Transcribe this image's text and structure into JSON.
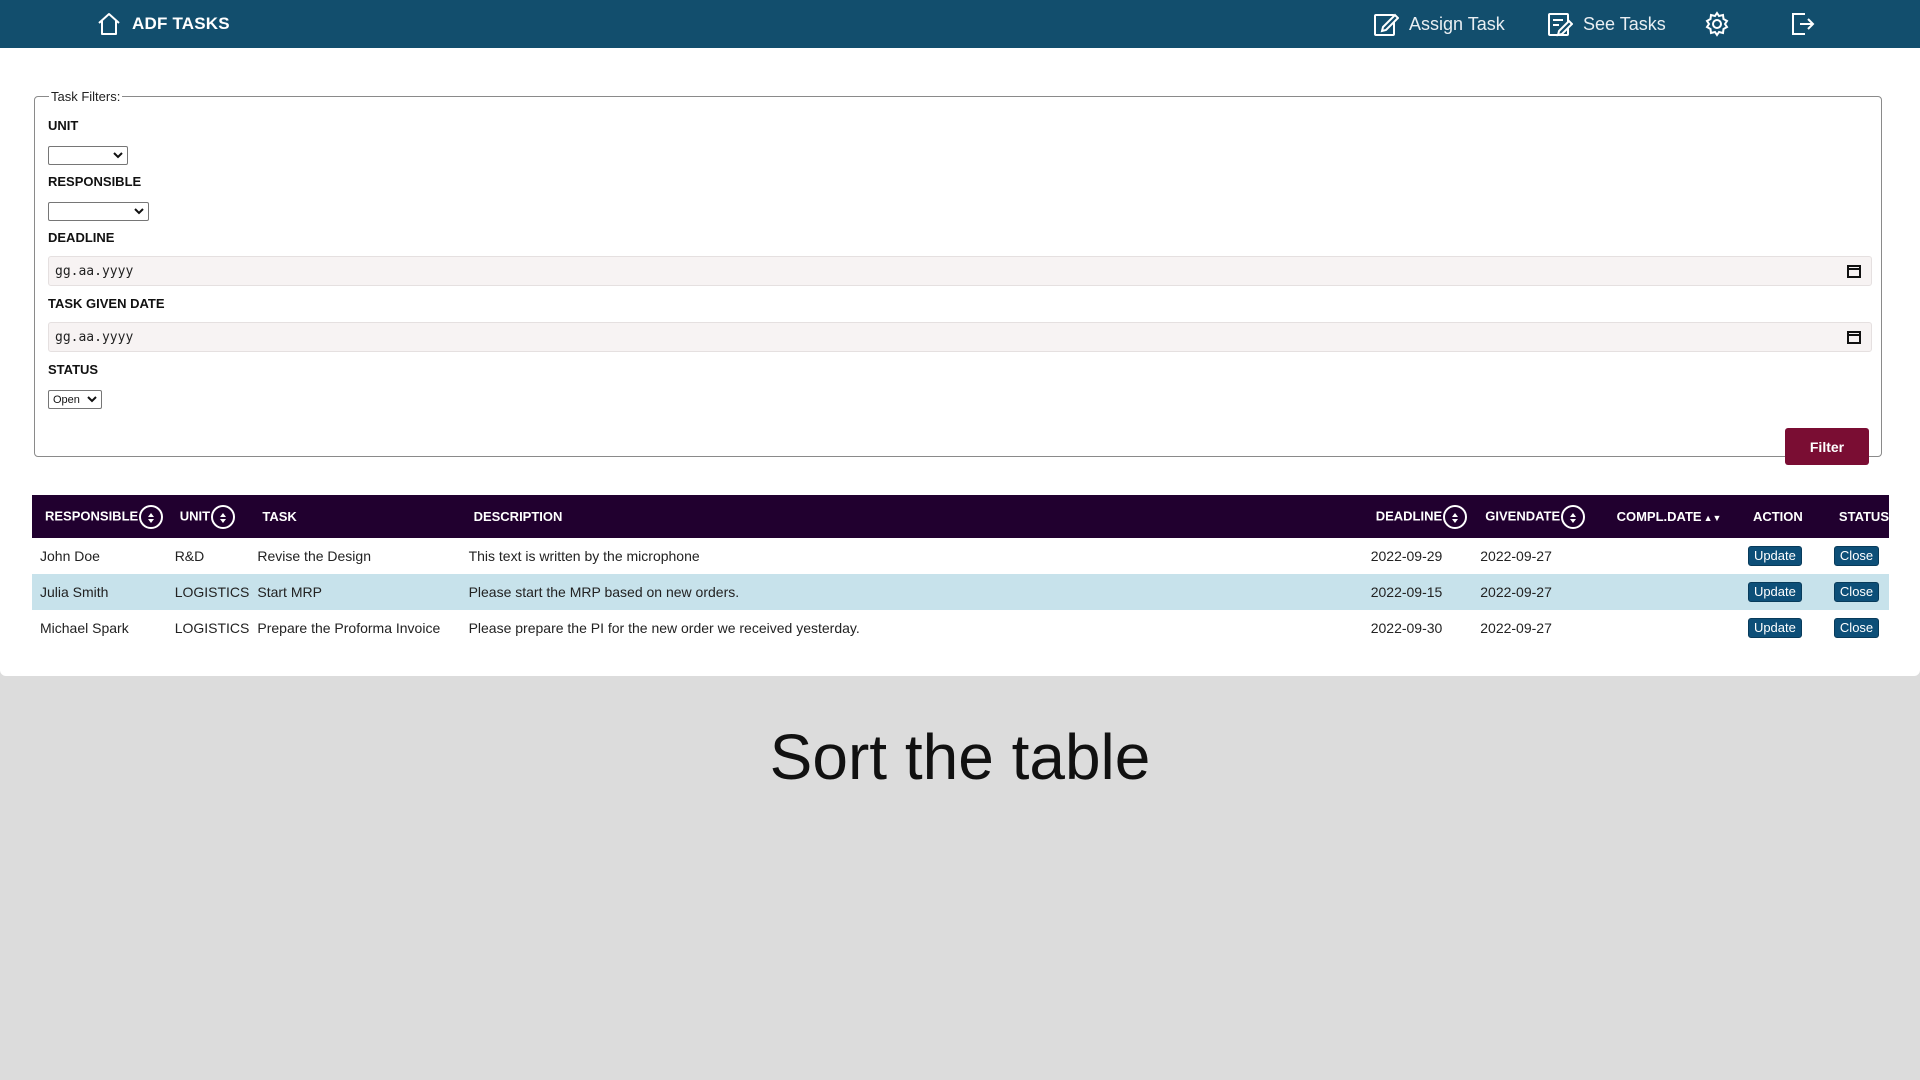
{
  "app": {
    "title": "ADF TASKS"
  },
  "nav": {
    "assign_task": "Assign Task",
    "see_tasks": "See Tasks"
  },
  "filters": {
    "legend": "Task Filters:",
    "unit_label": "UNIT",
    "unit_value": "",
    "responsible_label": "RESPONSIBLE",
    "responsible_value": "",
    "deadline_label": "DEADLINE",
    "deadline_placeholder": "gg.aa.yyyy",
    "given_label": "TASK GIVEN DATE",
    "given_placeholder": "gg.aa.yyyy",
    "status_label": "STATUS",
    "status_value": "Open",
    "filter_button": "Filter"
  },
  "table": {
    "headers": {
      "responsible": "RESPONSIBLE",
      "unit": "UNIT",
      "task": "TASK",
      "description": "DESCRIPTION",
      "deadline": "DEADLINE",
      "givendate": "GIVENDATE",
      "compl_date": "COMPL.DATE",
      "action": "ACTION",
      "status": "STATUS"
    },
    "update_label": "Update",
    "close_label": "Close",
    "rows": [
      {
        "responsible": "John Doe",
        "unit": "R&D",
        "task": "Revise the Design",
        "description": "This text is written by the microphone",
        "deadline": "2022-09-29",
        "givendate": "2022-09-27",
        "compl_date": ""
      },
      {
        "responsible": "Julia Smith",
        "unit": "LOGISTICS",
        "task": "Start MRP",
        "description": "Please start the MRP based on new orders.",
        "deadline": "2022-09-15",
        "givendate": "2022-09-27",
        "compl_date": ""
      },
      {
        "responsible": "Michael Spark",
        "unit": "LOGISTICS",
        "task": "Prepare the Proforma Invoice",
        "description": "Please prepare the PI for the new order we received yesterday.",
        "deadline": "2022-09-30",
        "givendate": "2022-09-27",
        "compl_date": ""
      }
    ]
  },
  "caption": "Sort the table",
  "colors": {
    "topbar": "#124e6d",
    "table_header": "#21002f",
    "filter_button": "#7a0d33",
    "highlight_row": "#c7e2eb",
    "action_button": "#0d4f78"
  }
}
